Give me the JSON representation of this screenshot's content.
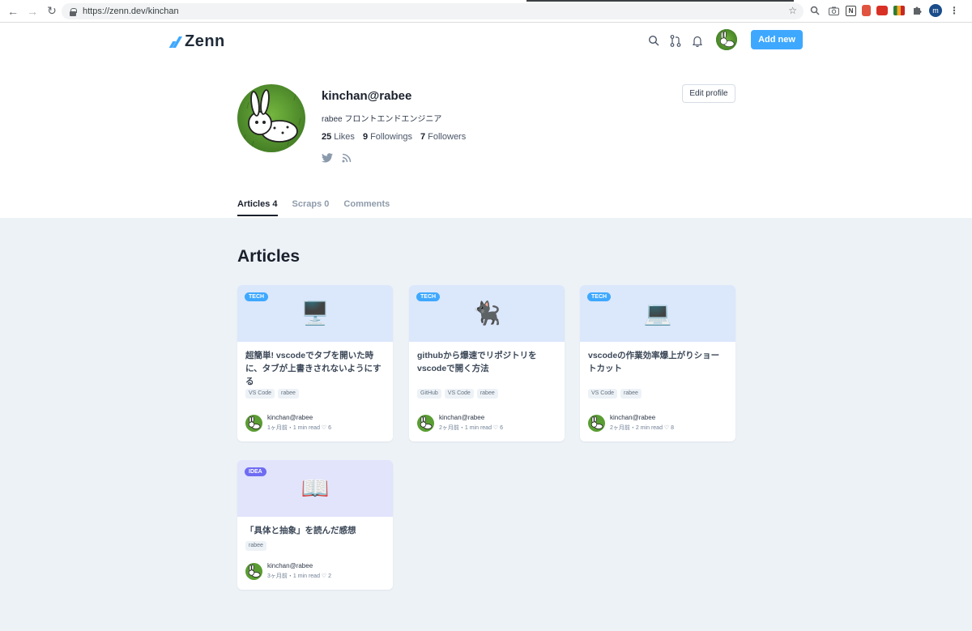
{
  "browser": {
    "url": "https://zenn.dev/kinchan",
    "profile_initial": "m"
  },
  "header": {
    "logo": "Zenn",
    "add_new": "Add new"
  },
  "profile": {
    "name": "kinchan@rabee",
    "bio": "rabee フロントエンドエンジニア",
    "edit_profile": "Edit profile",
    "stats": [
      {
        "count": "25",
        "label": "Likes"
      },
      {
        "count": "9",
        "label": "Followings"
      },
      {
        "count": "7",
        "label": "Followers"
      }
    ]
  },
  "tabs": [
    {
      "label": "Articles 4",
      "active": true
    },
    {
      "label": "Scraps 0",
      "active": false
    },
    {
      "label": "Comments",
      "active": false
    }
  ],
  "section_title": "Articles",
  "articles": [
    {
      "badge": "TECH",
      "emoji": "🖥️",
      "title": "超簡単! vscodeでタブを開いた時に、タブが上書きされないようにする",
      "tags": [
        "VS Code",
        "rabee"
      ],
      "author": "kinchan@rabee",
      "meta": "1ヶ月前・1 min read ♡ 6"
    },
    {
      "badge": "TECH",
      "emoji": "🐈‍⬛",
      "title": "githubから爆速でリポジトリをvscodeで開く方法",
      "tags": [
        "GitHub",
        "VS Code",
        "rabee"
      ],
      "author": "kinchan@rabee",
      "meta": "2ヶ月前・1 min read ♡ 6"
    },
    {
      "badge": "TECH",
      "emoji": "💻",
      "title": "vscodeの作業効率爆上がりショートカット",
      "tags": [
        "VS Code",
        "rabee"
      ],
      "author": "kinchan@rabee",
      "meta": "2ヶ月前・2 min read ♡ 8"
    },
    {
      "badge": "IDEA",
      "emoji": "📖",
      "title": "「具体と抽象」を読んだ感想",
      "tags": [
        "rabee"
      ],
      "author": "kinchan@rabee",
      "meta": "3ヶ月前・1 min read ♡ 2"
    }
  ]
}
